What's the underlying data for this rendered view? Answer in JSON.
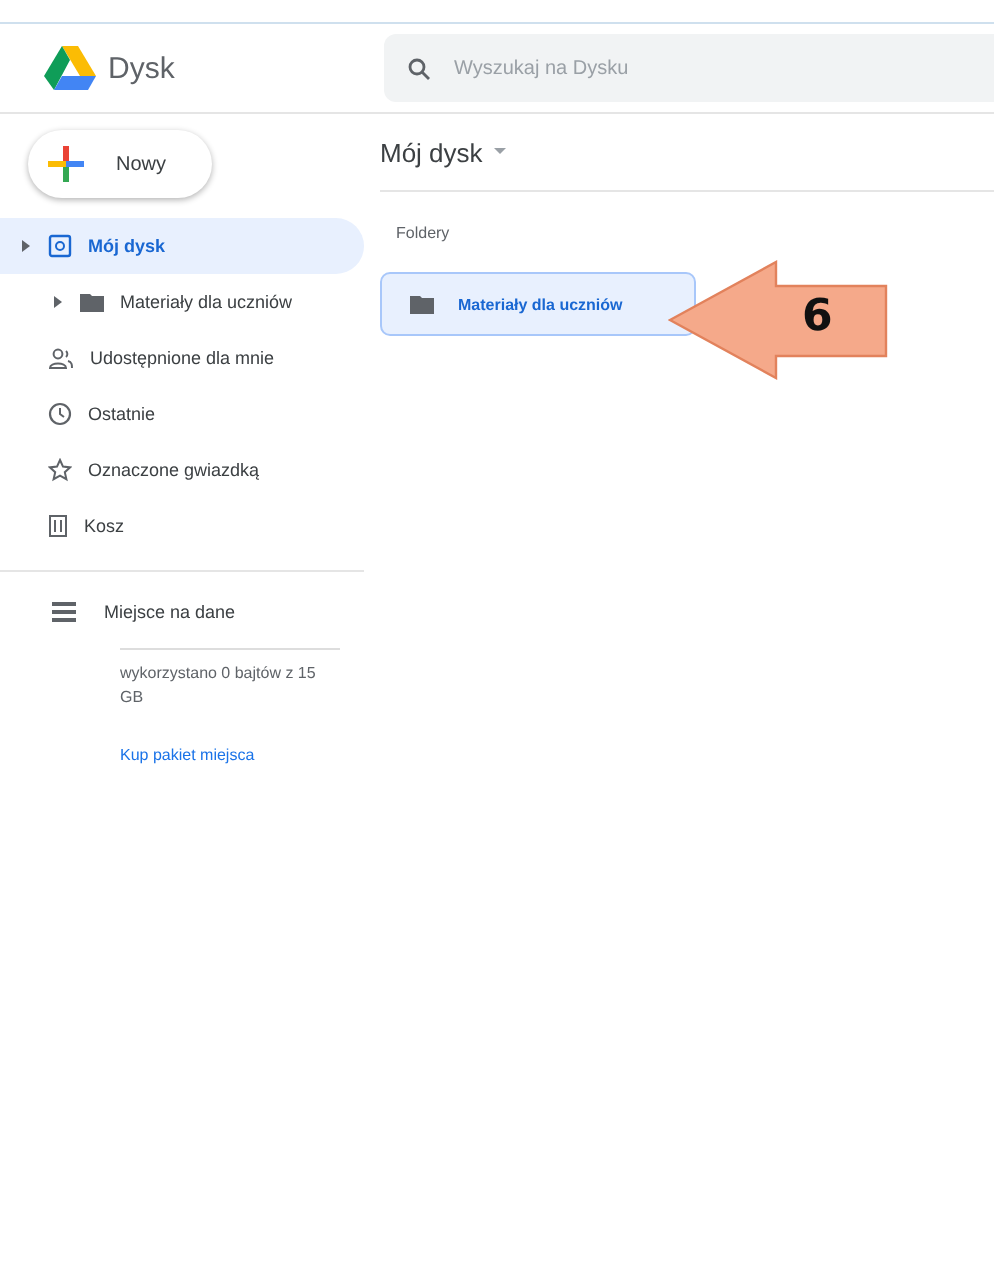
{
  "app": {
    "name": "Dysk"
  },
  "search": {
    "placeholder": "Wyszukaj na Dysku"
  },
  "new_button": {
    "label": "Nowy"
  },
  "nav": [
    {
      "kind": "drive",
      "label": "Mój dysk",
      "selected": true,
      "children": [
        {
          "kind": "folder",
          "label": "Materiały dla uczniów",
          "selected": false
        }
      ]
    },
    {
      "kind": "shared",
      "label": "Udostępnione dla mnie",
      "selected": false
    },
    {
      "kind": "recent",
      "label": "Ostatnie",
      "selected": false
    },
    {
      "kind": "starred",
      "label": "Oznaczone gwiazdką",
      "selected": false
    },
    {
      "kind": "trash",
      "label": "Kosz",
      "selected": false
    }
  ],
  "storage": {
    "label": "Miejsce na dane",
    "usage": "wykorzystano 0 bajtów z 15 GB",
    "buy_link": "Kup pakiet miejsca"
  },
  "breadcrumb": "Mój dysk",
  "section": "Foldery",
  "folders": [
    {
      "name": "Materiały dla uczniów",
      "selected": true
    }
  ],
  "annotation": {
    "number": "6"
  }
}
